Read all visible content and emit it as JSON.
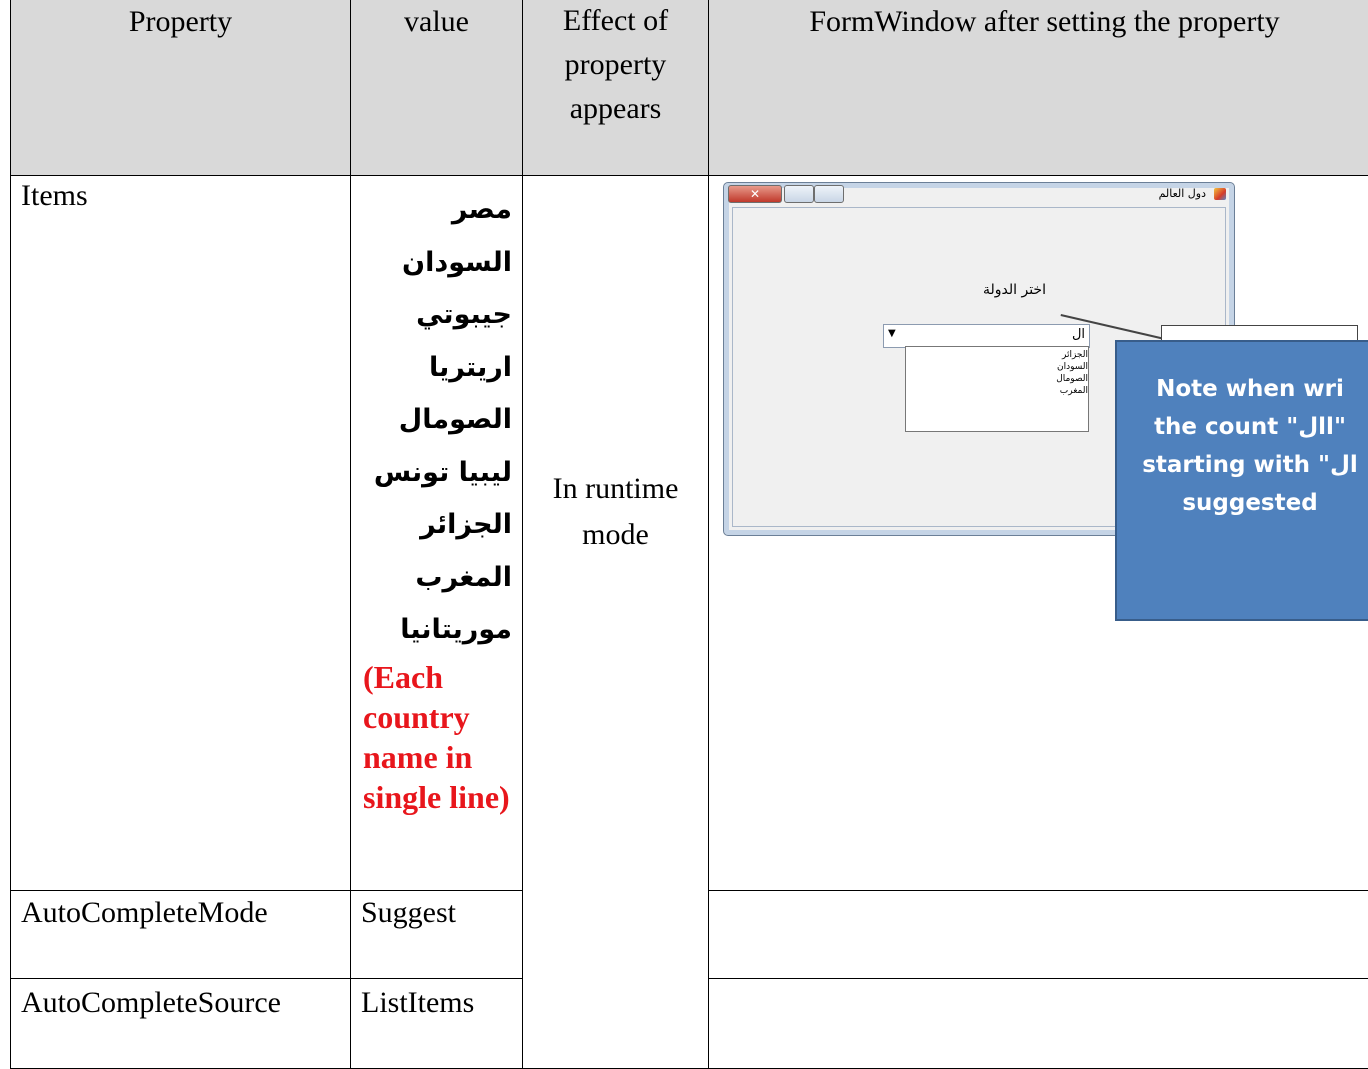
{
  "table": {
    "headers": {
      "property": "Property",
      "value": "value",
      "effect": "Effect of property appears",
      "form_window": "FormWindow after setting the property"
    },
    "rows": [
      {
        "property": "Items",
        "value_items": [
          "مصر",
          "السودان",
          "جيبوتي",
          "اريتريا",
          "الصومال",
          "ليبيا تونس",
          "الجزائر",
          "المغرب",
          "موريتانيا"
        ],
        "value_note": "(Each country name in single line)"
      },
      {
        "property": "AutoCompleteMode",
        "value": "Suggest"
      },
      {
        "property": "AutoCompleteSource",
        "value": "ListItems"
      }
    ],
    "effect": "In runtime mode"
  },
  "screenshot": {
    "window_title": "دول العالم",
    "label_text": "اختر الدولة",
    "combo_value": "ال",
    "dropdown_items": [
      "الجزائر",
      "السودان",
      "الصومال",
      "المغرب"
    ],
    "callout_lines": [
      "Note when wri",
      "the count \"اال\"",
      "starting with \"ال",
      "suggested"
    ]
  },
  "colors": {
    "header_bg": "#d9d9d9",
    "note_red": "#e8161c",
    "callout_fill": "#4f81bd"
  }
}
